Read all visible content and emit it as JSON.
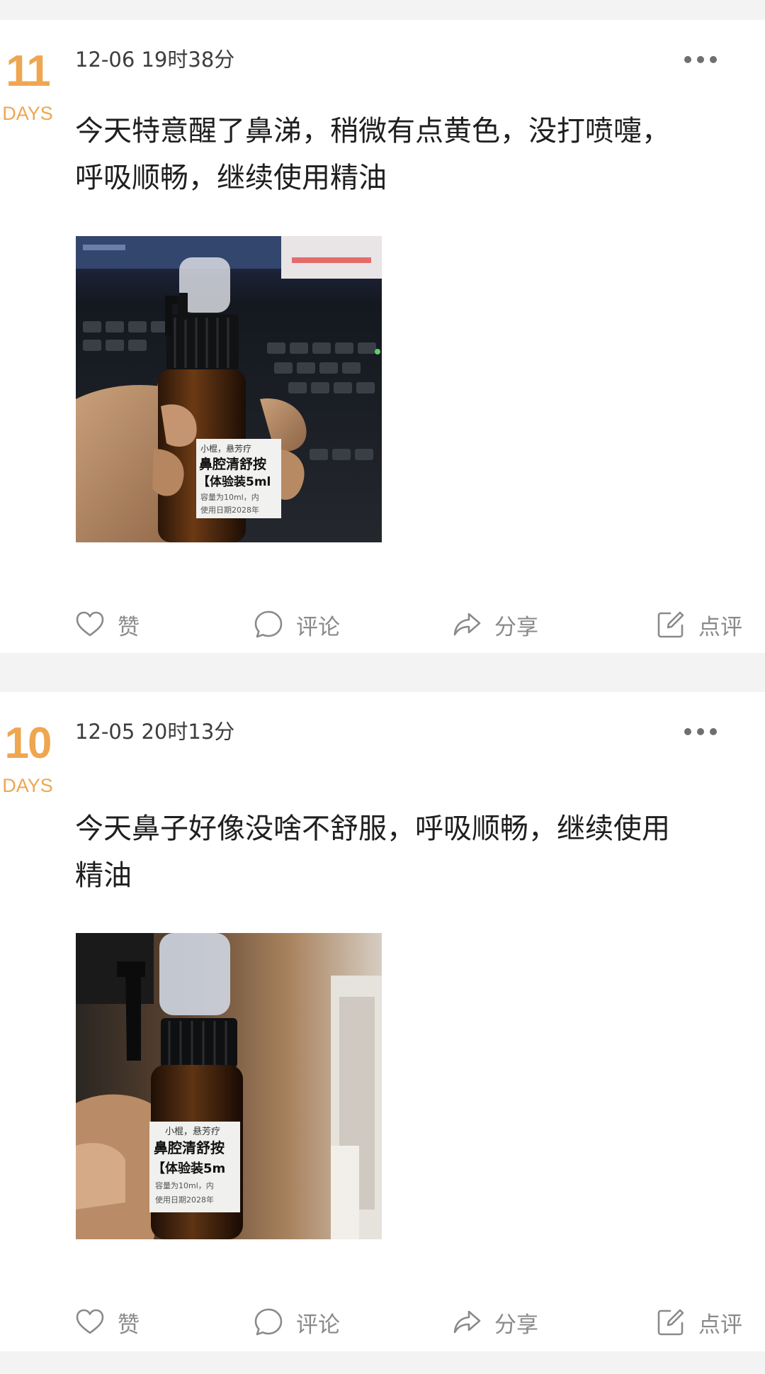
{
  "posts": [
    {
      "day_number": "11",
      "day_unit": "DAYS",
      "timestamp": "12-06 19时38分",
      "text_line1": "今天特意醒了鼻涕，稍微有点黄色，没打喷嚏，",
      "text_line2": "呼吸顺畅，继续使用精油",
      "photo_label": {
        "line1": "小棍，悬芳疗",
        "line2": "鼻腔清舒按",
        "line3": "【体验装5ml",
        "line4": "容量为10ml，内",
        "line5": "使用日期2028年"
      }
    },
    {
      "day_number": "10",
      "day_unit": "DAYS",
      "timestamp": "12-05 20时13分",
      "text_line1": "今天鼻子好像没啥不舒服，呼吸顺畅，继续使用",
      "text_line2": "精油",
      "photo_label": {
        "line1": "小棍，悬芳疗",
        "line2": "鼻腔清舒按",
        "line3": "【体验装5m",
        "line4": "容量为10ml，内",
        "line5": "使用日期2028年"
      }
    }
  ],
  "actions": {
    "like": "赞",
    "comment": "评论",
    "share": "分享",
    "review": "点评"
  },
  "icons": {
    "like": "heart-icon",
    "comment": "speech-bubble-icon",
    "share": "share-arrow-icon",
    "review": "edit-icon",
    "more": "more-dots-icon"
  },
  "colors": {
    "accent": "#efa650",
    "text": "#1f1f1f",
    "muted": "#8a8a8a",
    "page_bg": "#f3f3f3"
  }
}
